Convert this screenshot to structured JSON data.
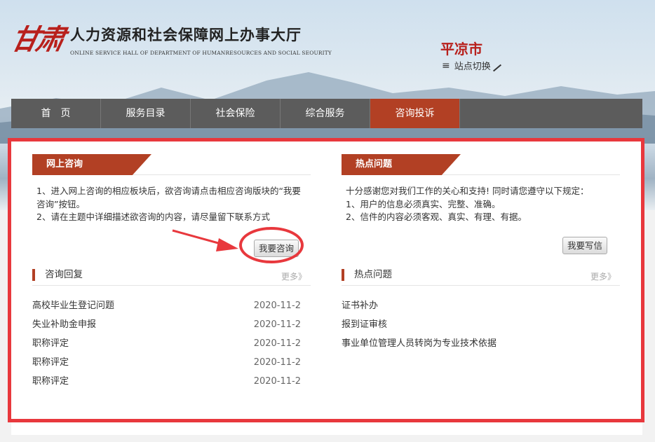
{
  "header": {
    "logo_mark": "甘肃",
    "title": "人力资源和社会保障网上办事大厅",
    "subtitle": "ONLINE SERVICE HALL OF DEPARTMENT OF HUMANRESOURCES AND SOCIAL SEOURITY",
    "city": "平凉市",
    "switch_label": "站点切换"
  },
  "nav": {
    "items": [
      {
        "label": "首　页"
      },
      {
        "label": "服务目录"
      },
      {
        "label": "社会保险"
      },
      {
        "label": "综合服务"
      },
      {
        "label": "咨询投诉"
      }
    ],
    "active_index": 4
  },
  "consult": {
    "tab": "网上咨询",
    "line1": "1、进入网上咨询的相应板块后，欲咨询请点击相应咨询版块的“我要",
    "line2": "咨询”按钮。",
    "line3": "2、请在主题中详细描述欲咨询的内容，请尽量留下联系方式",
    "button": "我要咨询",
    "replies_title": "咨询回复",
    "more": "更多》",
    "replies": [
      {
        "title": "高校毕业生登记问题",
        "date": "2020-11-2"
      },
      {
        "title": "失业补助金申报",
        "date": "2020-11-2"
      },
      {
        "title": "职称评定",
        "date": "2020-11-2"
      },
      {
        "title": "职称评定",
        "date": "2020-11-2"
      },
      {
        "title": "职称评定",
        "date": "2020-11-2"
      }
    ]
  },
  "hot": {
    "tab": "热点问题",
    "line1": "十分感谢您对我们工作的关心和支持! 同时请您遵守以下规定：",
    "line2": "1、用户的信息必须真实、完整、准确。",
    "line3": "2、信件的内容必须客观、真实、有理、有据。",
    "button": "我要写信",
    "list_title": "热点问题",
    "more": "更多》",
    "items": [
      {
        "title": "证书补办"
      },
      {
        "title": "报到证审核"
      },
      {
        "title": "事业单位管理人员转岗为专业技术依据"
      }
    ]
  },
  "colors": {
    "accent": "#b24024",
    "annotation": "#e8383d",
    "nav_bg": "#5c5c5c",
    "brand_red": "#b8201c"
  }
}
